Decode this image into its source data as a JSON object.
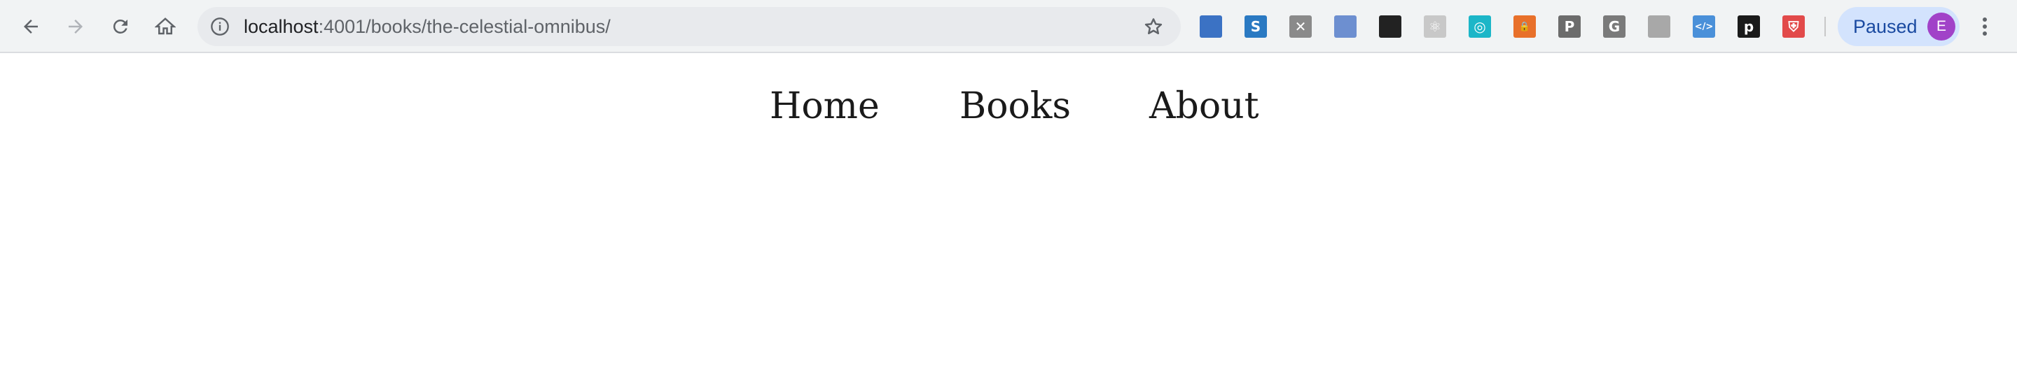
{
  "browser": {
    "url_host": "localhost",
    "url_path": ":4001/books/the-celestial-omnibus/",
    "profile_label": "Paused",
    "profile_initial": "E",
    "extensions": [
      {
        "name": "onepassword-extension-icon",
        "glyph": "",
        "color": "#3b72c4"
      },
      {
        "name": "s-extension-icon",
        "glyph": "S",
        "color": "#2a79c2"
      },
      {
        "name": "blocked-extension-icon",
        "glyph": "✕",
        "color": "#8a8a8a"
      },
      {
        "name": "blue-circle-extension-icon",
        "glyph": "",
        "color": "#6d8fd0"
      },
      {
        "name": "dark-mode-extension-icon",
        "glyph": "",
        "color": "#222222"
      },
      {
        "name": "react-devtools-icon",
        "glyph": "⚛",
        "color": "#c8c8c8"
      },
      {
        "name": "teal-ring-extension-icon",
        "glyph": "◎",
        "color": "#1cb6c8"
      },
      {
        "name": "lock-extension-icon",
        "glyph": "🔒",
        "color": "#e8702a"
      },
      {
        "name": "p-extension-icon",
        "glyph": "P",
        "color": "#6c6c6c"
      },
      {
        "name": "g-extension-icon",
        "glyph": "G",
        "color": "#7a7a7a"
      },
      {
        "name": "gray-box-extension-icon",
        "glyph": "",
        "color": "#a8a8a8"
      },
      {
        "name": "code-extension-icon",
        "glyph": "</>",
        "color": "#4a90d9"
      },
      {
        "name": "pinboard-extension-icon",
        "glyph": "p",
        "color": "#1a1a1a"
      },
      {
        "name": "shield-extension-icon",
        "glyph": "⛨",
        "color": "#e24a4a"
      }
    ]
  },
  "nav": {
    "home_label": "Home",
    "books_label": "Books",
    "about_label": "About"
  }
}
